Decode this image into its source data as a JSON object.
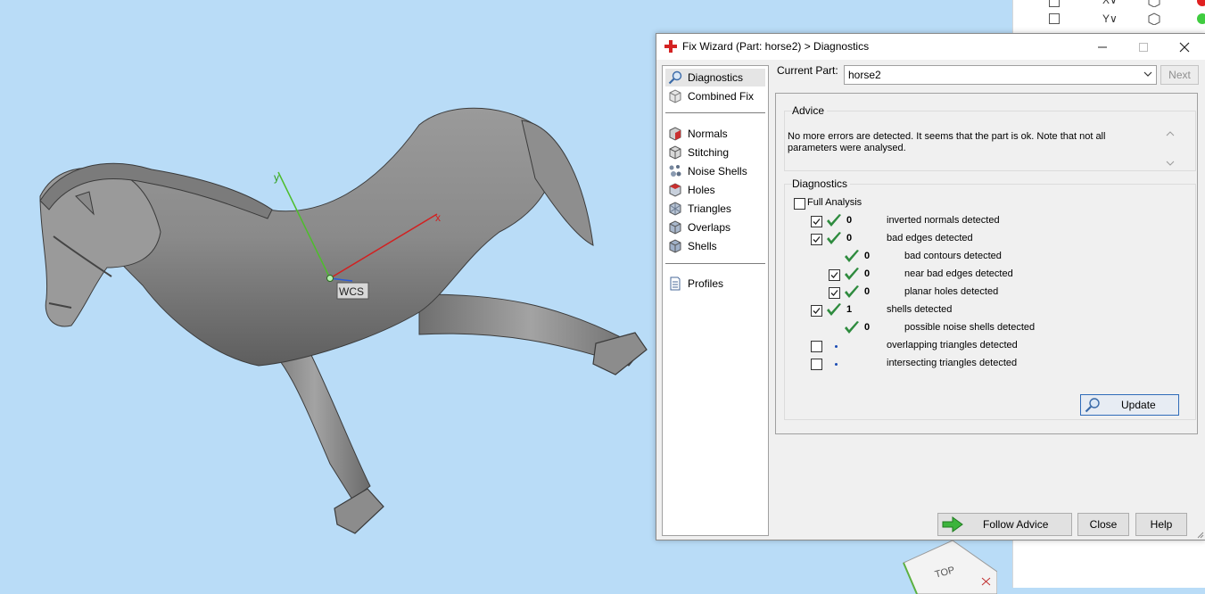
{
  "dialog": {
    "title": "Fix Wizard (Part: horse2) > Diagnostics",
    "window_controls": [
      "minimize-icon",
      "maximize-icon",
      "close-icon"
    ]
  },
  "nav": {
    "top_items": [
      {
        "label": "Diagnostics",
        "icon": "magnifier-icon",
        "selected": true
      },
      {
        "label": "Combined Fix",
        "icon": "cube-icon",
        "selected": false
      }
    ],
    "fix_items": [
      {
        "label": "Normals",
        "icon": "normals-cube-icon"
      },
      {
        "label": "Stitching",
        "icon": "stitching-cube-icon"
      },
      {
        "label": "Noise Shells",
        "icon": "noise-shells-icon"
      },
      {
        "label": "Holes",
        "icon": "holes-cube-icon"
      },
      {
        "label": "Triangles",
        "icon": "triangles-cube-icon"
      },
      {
        "label": "Overlaps",
        "icon": "overlaps-cube-icon"
      },
      {
        "label": "Shells",
        "icon": "shells-cube-icon"
      }
    ],
    "bottom_items": [
      {
        "label": "Profiles",
        "icon": "document-icon"
      }
    ]
  },
  "current_part": {
    "label": "Current Part:",
    "value": "horse2",
    "next_label": "Next"
  },
  "advice": {
    "title": "Advice",
    "text": "No more errors are detected. It seems that the part is ok. Note that not all\nparameters were analysed."
  },
  "diagnostics": {
    "title": "Diagnostics",
    "full_analysis_label": "Full Analysis",
    "full_analysis_checked": false,
    "rows": [
      {
        "label": "inverted normals detected",
        "count": "0",
        "checkbox": true,
        "checked": true,
        "status": "ok",
        "indent": 0
      },
      {
        "label": "bad edges detected",
        "count": "0",
        "checkbox": true,
        "checked": true,
        "status": "ok",
        "indent": 0
      },
      {
        "label": "bad contours detected",
        "count": "0",
        "checkbox": false,
        "checked": false,
        "status": "ok",
        "indent": 1
      },
      {
        "label": "near bad edges detected",
        "count": "0",
        "checkbox": true,
        "checked": true,
        "status": "ok",
        "indent": 1
      },
      {
        "label": "planar holes detected",
        "count": "0",
        "checkbox": true,
        "checked": true,
        "status": "ok",
        "indent": 1
      },
      {
        "label": "shells detected",
        "count": "1",
        "checkbox": true,
        "checked": true,
        "status": "ok",
        "indent": 0
      },
      {
        "label": "possible noise shells detected",
        "count": "0",
        "checkbox": false,
        "checked": false,
        "status": "ok",
        "indent": 1
      },
      {
        "label": "overlapping triangles detected",
        "count": "",
        "checkbox": true,
        "checked": false,
        "status": "not-analysed",
        "indent": 0
      },
      {
        "label": "intersecting triangles detected",
        "count": "",
        "checkbox": true,
        "checked": false,
        "status": "not-analysed",
        "indent": 0
      }
    ],
    "update_label": "Update"
  },
  "buttons": {
    "follow_advice": "Follow Advice",
    "close": "Close",
    "help": "Help"
  },
  "viewport": {
    "wcs_label": "WCS",
    "axis_x_label": "x",
    "axis_y_label": "y",
    "viewcube_label": "TOP",
    "right_strip_axes": [
      "X∨",
      "Y∨"
    ]
  },
  "colors": {
    "viewport_bg": "#b9dcf7",
    "check_green": "#2e8b3e",
    "update_border": "#2f6bb9"
  }
}
